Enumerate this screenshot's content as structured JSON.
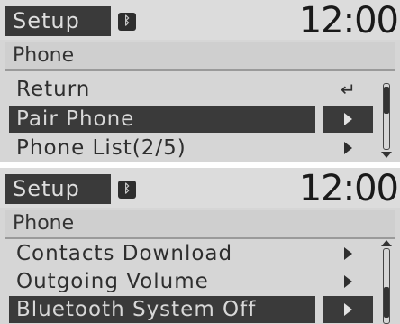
{
  "screen_1": {
    "title": "Setup",
    "bluetooth_icon": "bluetooth-icon",
    "clock": "12:00",
    "subtitle": "Phone",
    "items": [
      {
        "label": "Return",
        "icon": "return-icon",
        "selected": false
      },
      {
        "label": "Pair Phone",
        "icon": "chevron-right-icon",
        "selected": true
      },
      {
        "label": "Phone List(2/5)",
        "icon": "chevron-right-icon",
        "selected": false
      }
    ]
  },
  "screen_2": {
    "title": "Setup",
    "bluetooth_icon": "bluetooth-icon",
    "clock": "12:00",
    "subtitle": "Phone",
    "items": [
      {
        "label": "Contacts Download",
        "icon": "chevron-right-icon",
        "selected": false
      },
      {
        "label": "Outgoing Volume",
        "icon": "chevron-right-icon",
        "selected": false
      },
      {
        "label": "Bluetooth System Off",
        "icon": "chevron-right-icon",
        "selected": true
      }
    ]
  },
  "colors": {
    "screen_bg": "#d6d6d6",
    "highlight": "#3a3a3a",
    "text": "#2e2e2e",
    "highlight_text": "#d8d8d8"
  }
}
